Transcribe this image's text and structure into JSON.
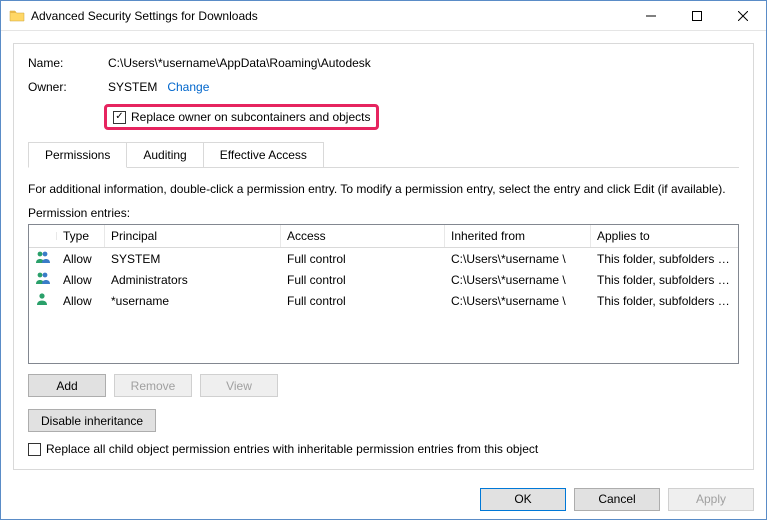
{
  "window": {
    "title": "Advanced Security Settings for Downloads"
  },
  "name_row": {
    "label": "Name:",
    "value": "C:\\Users\\*username\\AppData\\Roaming\\Autodesk"
  },
  "owner_row": {
    "label": "Owner:",
    "value": "SYSTEM",
    "change": "Change"
  },
  "replace_owner": {
    "checked": true,
    "label": "Replace owner on subcontainers and objects"
  },
  "tabs": {
    "items": [
      {
        "label": "Permissions",
        "active": true
      },
      {
        "label": "Auditing",
        "active": false
      },
      {
        "label": "Effective Access",
        "active": false
      }
    ]
  },
  "info_text": "For additional information, double-click a permission entry. To modify a permission entry, select the entry and click Edit (if available).",
  "entries_label": "Permission entries:",
  "grid": {
    "headers": {
      "icon": "",
      "type": "Type",
      "principal": "Principal",
      "access": "Access",
      "inherited": "Inherited from",
      "applies": "Applies to"
    },
    "rows": [
      {
        "icon": "group",
        "type": "Allow",
        "principal": "SYSTEM",
        "access": "Full control",
        "inherited": "C:\\Users\\*username \\",
        "applies": "This folder, subfolders and files"
      },
      {
        "icon": "group",
        "type": "Allow",
        "principal": "Administrators",
        "access": "Full control",
        "inherited": "C:\\Users\\*username \\",
        "applies": "This folder, subfolders and files"
      },
      {
        "icon": "user",
        "type": "Allow",
        "principal": "*username",
        "access": "Full control",
        "inherited": "C:\\Users\\*username \\",
        "applies": "This folder, subfolders and files"
      }
    ]
  },
  "buttons": {
    "add": "Add",
    "remove": "Remove",
    "view": "View",
    "disable_inheritance": "Disable inheritance"
  },
  "replace_child": {
    "checked": false,
    "label": "Replace all child object permission entries with inheritable permission entries from this object"
  },
  "footer": {
    "ok": "OK",
    "cancel": "Cancel",
    "apply": "Apply"
  }
}
